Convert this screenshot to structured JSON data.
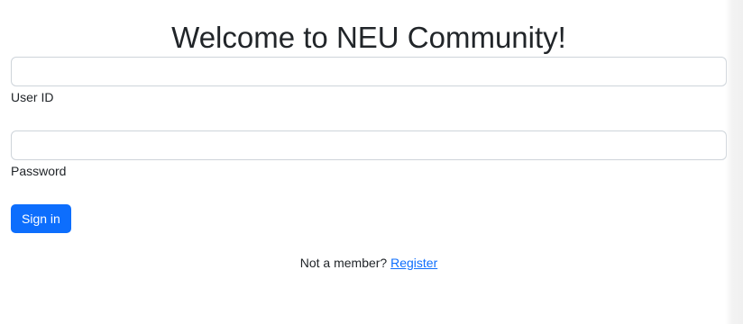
{
  "page": {
    "title": "Welcome to NEU Community!"
  },
  "form": {
    "userid_label": "User ID",
    "userid_value": "",
    "password_label": "Password",
    "password_value": "",
    "signin_label": "Sign in"
  },
  "footer": {
    "prompt_text": "Not a member? ",
    "register_label": "Register"
  },
  "colors": {
    "primary": "#0d6efd",
    "text": "#212529",
    "input_border": "#ced4da"
  }
}
